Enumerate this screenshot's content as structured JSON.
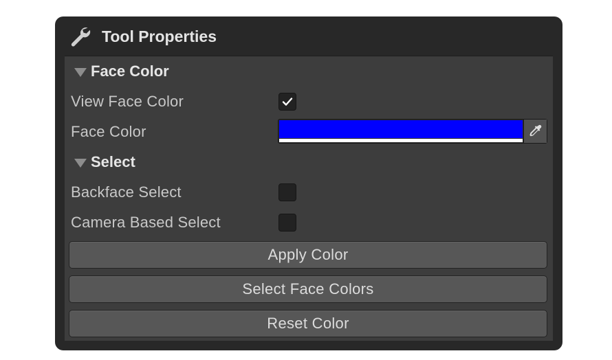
{
  "window": {
    "title": "Tool Properties",
    "title_icon": "wrench-icon"
  },
  "sections": {
    "face_color": {
      "label": "Face Color",
      "view_face_color": {
        "label": "View Face Color",
        "checked": true
      },
      "face_color_field": {
        "label": "Face Color",
        "color": "#0000ff",
        "alpha_color": "#ffffff",
        "picker_icon": "eyedropper-icon"
      }
    },
    "select": {
      "label": "Select",
      "backface_select": {
        "label": "Backface Select",
        "checked": false
      },
      "camera_based_select": {
        "label": "Camera Based Select",
        "checked": false
      }
    }
  },
  "buttons": {
    "apply_color": "Apply Color",
    "select_face_colors": "Select Face Colors",
    "reset_color": "Reset Color"
  },
  "colors": {
    "window_bg": "#282828",
    "panel_bg": "#3d3d3d",
    "button_bg": "#575757"
  }
}
